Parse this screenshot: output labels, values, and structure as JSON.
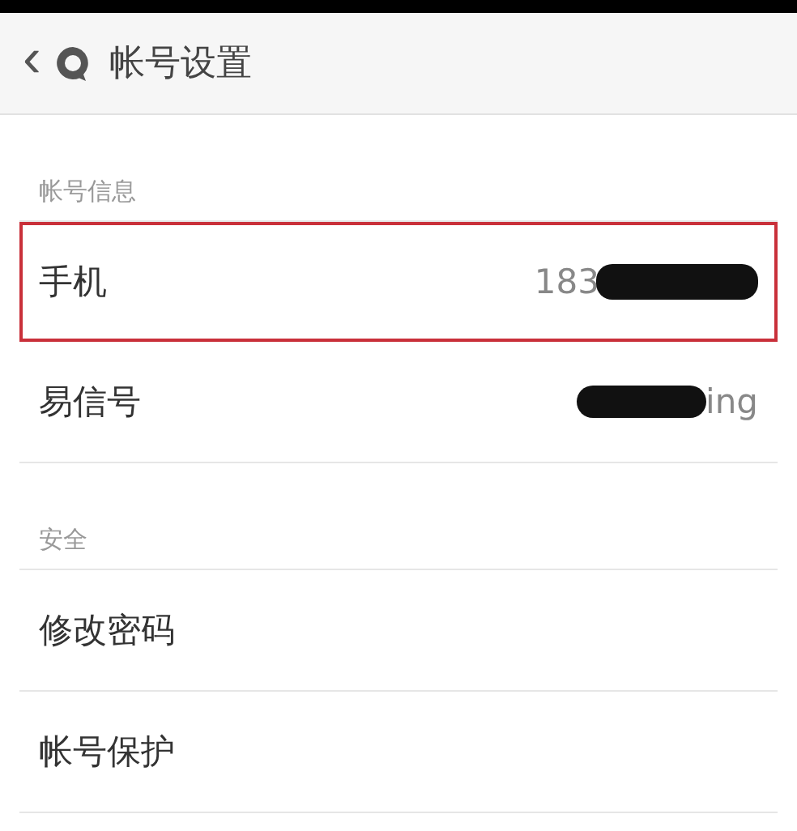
{
  "header": {
    "back": "‹",
    "title": "帐号设置"
  },
  "sections": [
    {
      "label": "帐号信息",
      "rows": [
        {
          "label": "手机",
          "value": "183",
          "redacted_before": false,
          "redacted_after": true,
          "highlighted": true
        },
        {
          "label": "易信号",
          "value": "ing",
          "redacted_before": true,
          "redacted_after": false,
          "highlighted": false
        }
      ]
    },
    {
      "label": "安全",
      "rows": [
        {
          "label": "修改密码",
          "highlighted": false
        },
        {
          "label": "帐号保护",
          "highlighted": false
        }
      ]
    }
  ]
}
